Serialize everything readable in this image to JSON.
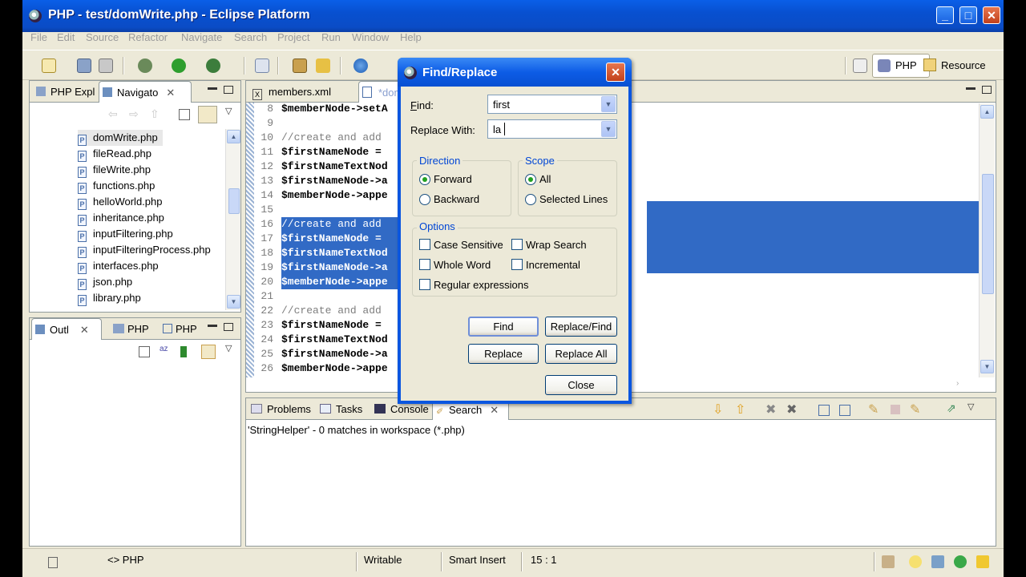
{
  "window": {
    "title": "PHP - test/domWrite.php - Eclipse Platform",
    "min": "_",
    "max": "□",
    "close": "✕"
  },
  "menu": [
    "File",
    "Edit",
    "Source",
    "Refactor",
    "Navigate",
    "Search",
    "Project",
    "Run",
    "Window",
    "Help"
  ],
  "perspectives": {
    "php": "PHP",
    "resource": "Resource"
  },
  "navigator": {
    "tabs": [
      "PHP Expl",
      "Navigato"
    ],
    "files": [
      "domWrite.php",
      "fileRead.php",
      "fileWrite.php",
      "functions.php",
      "helloWorld.php",
      "inheritance.php",
      "inputFiltering.php",
      "inputFilteringProcess.php",
      "interfaces.php",
      "json.php",
      "library.php"
    ]
  },
  "outline": {
    "tabs": [
      "Outl",
      "PHP",
      "PHP"
    ]
  },
  "editor": {
    "tabs": [
      "members.xml",
      "*dom"
    ],
    "lines": [
      {
        "n": "8",
        "text": "$memberNode->setA",
        "kind": "code"
      },
      {
        "n": "9",
        "text": "",
        "kind": "code"
      },
      {
        "n": "10",
        "text": "//create and add",
        "kind": "comment"
      },
      {
        "n": "11",
        "text": "$firstNameNode = ",
        "kind": "code"
      },
      {
        "n": "12",
        "text": "$firstNameTextNod",
        "kind": "code"
      },
      {
        "n": "13",
        "text": "$firstNameNode->a",
        "kind": "code"
      },
      {
        "n": "14",
        "text": "$memberNode->appe",
        "kind": "code"
      },
      {
        "n": "15",
        "text": "",
        "kind": "code"
      },
      {
        "n": "16",
        "text": "//create and add",
        "kind": "comment",
        "selected": true
      },
      {
        "n": "17",
        "text": "$firstNameNode = ",
        "kind": "code",
        "selected": true
      },
      {
        "n": "18",
        "text": "$firstNameTextNod",
        "kind": "code",
        "selected": true
      },
      {
        "n": "19",
        "text": "$firstNameNode->a",
        "kind": "code",
        "selected": true
      },
      {
        "n": "20",
        "text": "$memberNode->appe",
        "kind": "code",
        "selected": true
      },
      {
        "n": "21",
        "text": "",
        "kind": "code"
      },
      {
        "n": "22",
        "text": "//create and add",
        "kind": "comment"
      },
      {
        "n": "23",
        "text": "$firstNameNode = ",
        "kind": "code"
      },
      {
        "n": "24",
        "text": "$firstNameTextNod",
        "kind": "code"
      },
      {
        "n": "25",
        "text": "$firstNameNode->a",
        "kind": "code"
      },
      {
        "n": "26",
        "text": "$memberNode->appe",
        "kind": "code"
      }
    ]
  },
  "bottom": {
    "tabs": [
      "Problems",
      "Tasks",
      "Console",
      "Search"
    ],
    "message": "'StringHelper' - 0 matches in workspace (*.php)"
  },
  "dialog": {
    "title": "Find/Replace",
    "find_label": "Find:",
    "find_value": "first",
    "replace_label": "Replace With:",
    "replace_value": "la",
    "direction_title": "Direction",
    "forward": "Forward",
    "backward": "Backward",
    "scope_title": "Scope",
    "all": "All",
    "selected_lines": "Selected Lines",
    "options_title": "Options",
    "case_sensitive": "Case Sensitive",
    "wrap_search": "Wrap Search",
    "whole_word": "Whole Word",
    "incremental": "Incremental",
    "regex": "Regular expressions",
    "find_btn": "Find",
    "replace_find_btn": "Replace/Find",
    "replace_btn": "Replace",
    "replace_all_btn": "Replace All",
    "close_btn": "Close"
  },
  "status": {
    "lang": "PHP",
    "writable": "Writable",
    "insert": "Smart Insert",
    "position": "15 : 1"
  }
}
